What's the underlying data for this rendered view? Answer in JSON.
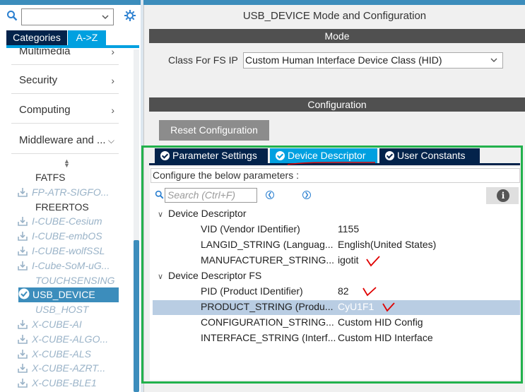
{
  "left_panel": {
    "search": {
      "value": "",
      "placeholder": ""
    },
    "tabs": {
      "categories": "Categories",
      "az": "A->Z"
    },
    "categories": [
      {
        "label": "Multimedia"
      },
      {
        "label": "Security"
      },
      {
        "label": "Computing"
      },
      {
        "label": "Middleware and ..."
      }
    ],
    "middleware_items": [
      {
        "label": "FATFS",
        "state": "plain"
      },
      {
        "label": "FP-ATR-SIGFO...",
        "state": "disabled"
      },
      {
        "label": "FREERTOS",
        "state": "plain"
      },
      {
        "label": "I-CUBE-Cesium",
        "state": "disabled"
      },
      {
        "label": "I-CUBE-embOS",
        "state": "disabled"
      },
      {
        "label": "I-CUBE-wolfSSL",
        "state": "disabled"
      },
      {
        "label": "I-Cube-SoM-uG...",
        "state": "disabled"
      },
      {
        "label": "TOUCHSENSING",
        "state": "disabled-noicon"
      },
      {
        "label": "USB_DEVICE",
        "state": "selected"
      },
      {
        "label": "USB_HOST",
        "state": "disabled-noicon"
      },
      {
        "label": "X-CUBE-AI",
        "state": "disabled"
      },
      {
        "label": "X-CUBE-ALGO...",
        "state": "disabled"
      },
      {
        "label": "X-CUBE-ALS",
        "state": "disabled"
      },
      {
        "label": "X-CUBE-AZRT...",
        "state": "disabled"
      },
      {
        "label": "X-CUBE-BLE1",
        "state": "disabled"
      }
    ]
  },
  "main": {
    "title": "USB_DEVICE Mode and Configuration",
    "mode_header": "Mode",
    "class_label": "Class For FS IP",
    "class_value": "Custom Human Interface Device Class (HID)",
    "config_header": "Configuration",
    "reset_button": "Reset Configuration",
    "tabs": [
      {
        "label": "Parameter Settings",
        "active": false
      },
      {
        "label": "Device Descriptor",
        "active": true
      },
      {
        "label": "User Constants",
        "active": false
      }
    ],
    "configure_text": "Configure the below parameters :",
    "search_placeholder": "Search (Ctrl+F)",
    "groups": [
      {
        "name": "Device Descriptor",
        "params": [
          {
            "name": "VID (Vendor IDentifier)",
            "value": "1155"
          },
          {
            "name": "LANGID_STRING (Languag...",
            "value": "English(United States)"
          },
          {
            "name": "MANUFACTURER_STRING...",
            "value": "igotit"
          }
        ]
      },
      {
        "name": "Device Descriptor FS",
        "params": [
          {
            "name": "PID (Product IDentifier)",
            "value": "82"
          },
          {
            "name": "PRODUCT_STRING (Produ...",
            "value": "CyU1F1"
          },
          {
            "name": "CONFIGURATION_STRING...",
            "value": "Custom HID Config"
          },
          {
            "name": "INTERFACE_STRING (Interf...",
            "value": "Custom HID Interface"
          }
        ]
      }
    ]
  },
  "colors": {
    "accent": "#00a0e0",
    "tab_dark": "#03234b",
    "annotation_box": "#22b14c",
    "annotation_marks": "#e00000",
    "selected_row": "#b9cde3"
  }
}
